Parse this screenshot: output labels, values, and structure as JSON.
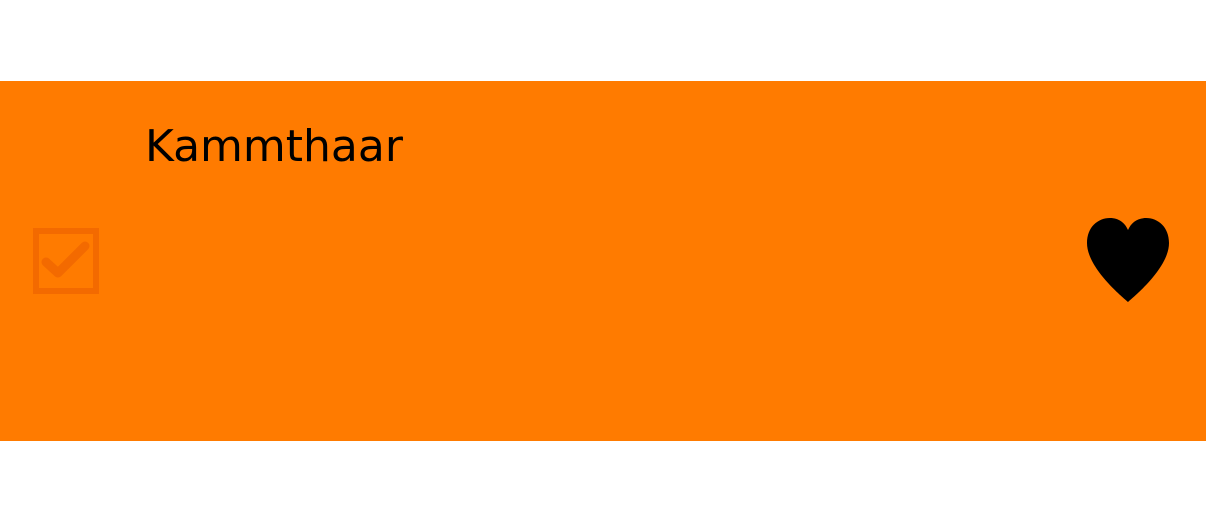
{
  "item": {
    "title": "Kammthaar",
    "checked": true,
    "favorite": true
  },
  "icons": {
    "checkbox": "checkbox-checked-icon",
    "favorite": "heart-filled-icon"
  },
  "colors": {
    "card_background": "#ff7b00",
    "checkbox": "#f36a00",
    "heart": "#000000",
    "title_text": "#000000",
    "page_background": "#ffffff"
  }
}
